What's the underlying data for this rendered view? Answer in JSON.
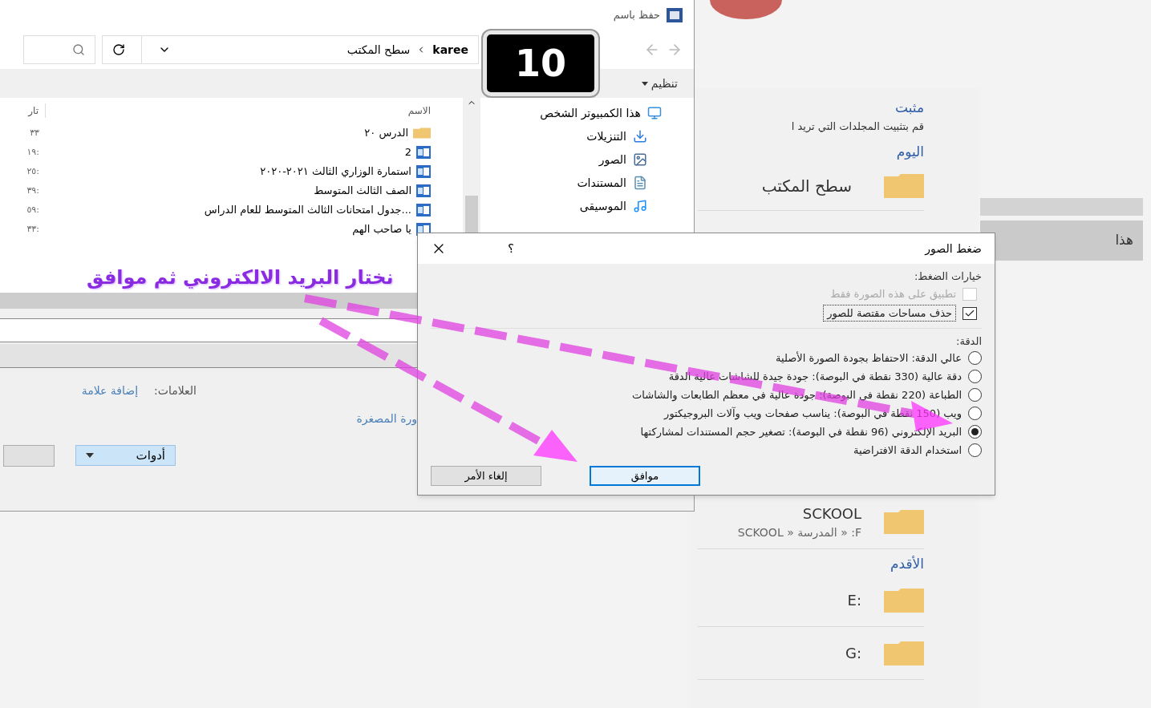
{
  "background_app": {
    "pinned_heading": "مثبت",
    "pinned_hint": "قم بتثبيت المجلدات التي تريد ا",
    "today_heading": "اليوم",
    "today_items": [
      {
        "name": "سطح المكتب"
      }
    ],
    "recent_items": [
      {
        "name": "SCKOOL",
        "path": "F: « المدرسة « SCKOOL"
      }
    ],
    "older_heading": "الأقدم",
    "older_items": [
      {
        "name": ":E"
      },
      {
        "name": ":G"
      }
    ],
    "side_item": "هذا"
  },
  "save_as": {
    "title": "حفظ باسم",
    "breadcrumb": [
      "karee",
      "سطح المكتب"
    ],
    "organize": "تنظيم",
    "nav_items": [
      {
        "label": "هذا الكمبيوتر الشخص",
        "kind": "computer"
      },
      {
        "label": "التنزيلات",
        "kind": "downloads"
      },
      {
        "label": "الصور",
        "kind": "pictures"
      },
      {
        "label": "المستندات",
        "kind": "documents"
      },
      {
        "label": "الموسيقى",
        "kind": "music"
      }
    ],
    "columns": [
      "الاسم",
      "تار"
    ],
    "files": [
      {
        "name": "الدرس ٢٠",
        "kind": "folder",
        "date": "٣٣"
      },
      {
        "name": "2",
        "kind": "doc",
        "date": ":١٩"
      },
      {
        "name": "استمارة الوزاري الثالث ٢٠٢١-٢٠٢٠",
        "kind": "doc",
        "date": ":٢٥"
      },
      {
        "name": "الصف الثالث المتوسط",
        "kind": "doc",
        "date": ":٣٩"
      },
      {
        "name": "...جدول امتحانات الثالث المتوسط للعام الدراس",
        "kind": "doc",
        "date": ":٥٩"
      },
      {
        "name": "يا صاحب الهم",
        "kind": "doc",
        "date": ":٣٣"
      }
    ],
    "tags_label": "العلامات:",
    "tags_value": "إضافة علامة",
    "thumbnail_label": "ورة المصغرة",
    "tools_button": "أدوات"
  },
  "compress_dialog": {
    "title": "ضغط الصور",
    "help": "؟",
    "options_heading": "خيارات الضغط:",
    "checkboxes": [
      {
        "label": "تطبيق على هذه الصورة فقط",
        "checked": false,
        "disabled": true
      },
      {
        "label": "حذف مساحات مقتصة للصور",
        "checked": true,
        "disabled": false
      }
    ],
    "resolution_heading": "الدقة:",
    "resolutions": [
      {
        "label": "عالي الدقة: الاحتفاظ بجودة الصورة الأصلية",
        "selected": false
      },
      {
        "label": "دقة عالية (330 نقطة في البوصة): جودة جيدة للشاشات عالية الدقة",
        "selected": false
      },
      {
        "label": "الطباعة (220 نقطة في البوصة): جودة عالية في معظم الطابعات والشاشات",
        "selected": false
      },
      {
        "label": "ويب (150 نقطة في البوصة): يناسب صفحات ويب وآلات البروجيكتور",
        "selected": false
      },
      {
        "label": "البريد الإلكتروني (96 نقطة في البوصة): تصغير حجم المستندات لمشاركتها",
        "selected": true
      },
      {
        "label": "استخدام الدقة الافتراضية",
        "selected": false
      }
    ],
    "buttons": [
      {
        "label": "موافق",
        "kind": "primary"
      },
      {
        "label": "إلغاء الأمر",
        "kind": "secondary"
      }
    ]
  },
  "annotation": {
    "step": "10",
    "caption": "نختار البريد الالكتروني ثم موافق"
  }
}
